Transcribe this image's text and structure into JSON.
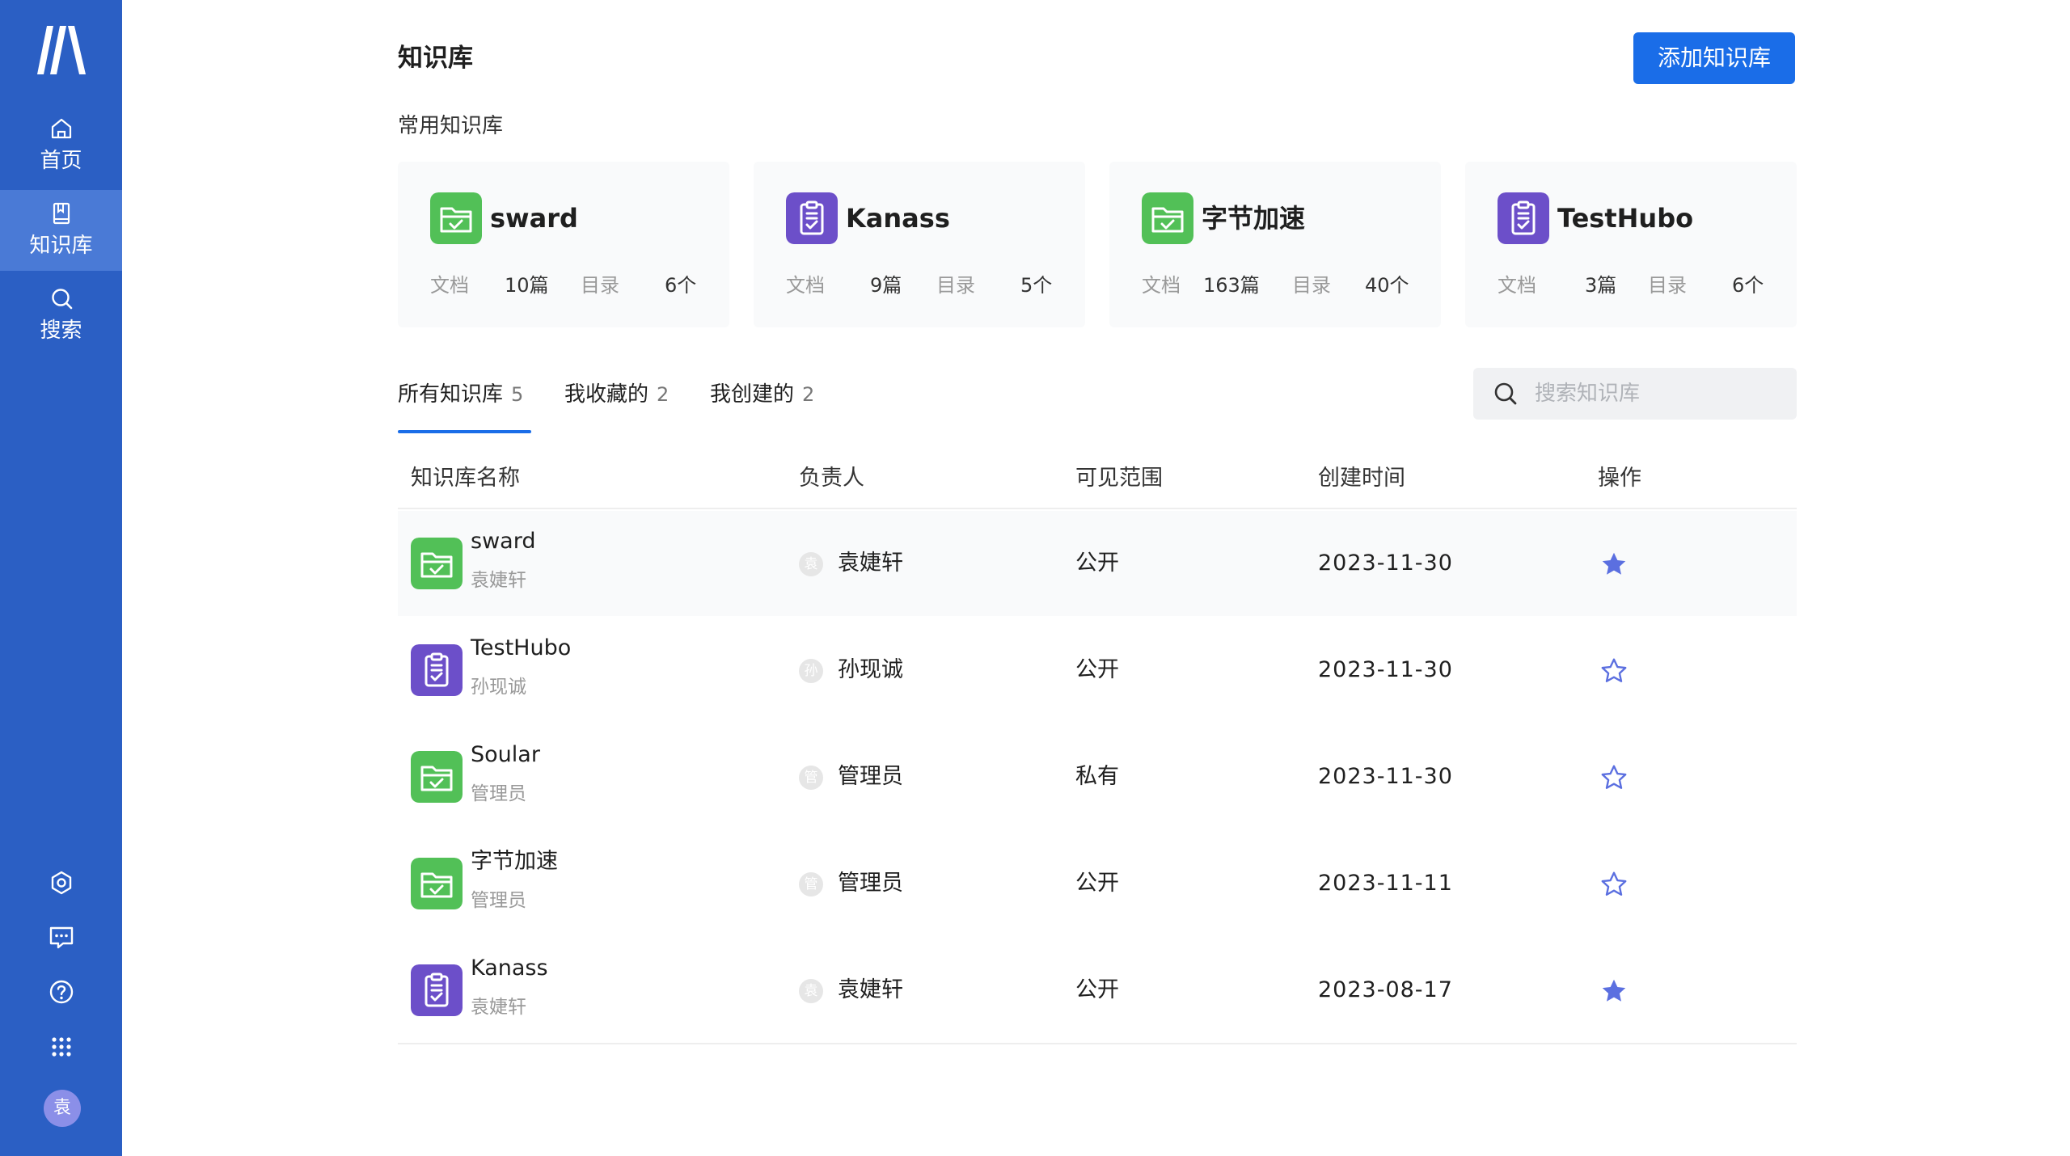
{
  "sidebar": {
    "nav": [
      {
        "label": "首页",
        "icon": "home-icon"
      },
      {
        "label": "知识库",
        "icon": "book-icon"
      },
      {
        "label": "搜索",
        "icon": "search-icon"
      }
    ],
    "bottom_icons": [
      "settings-icon",
      "message-icon",
      "help-icon",
      "apps-grid-icon"
    ],
    "user_avatar": "袁"
  },
  "header": {
    "title": "知识库",
    "add_button": "添加知识库"
  },
  "common_section": {
    "title": "常用知识库",
    "cards": [
      {
        "name": "sward",
        "type": "folder",
        "doc_label": "文档",
        "doc_count": "10篇",
        "dir_label": "目录",
        "dir_count": "6个"
      },
      {
        "name": "Kanass",
        "type": "clipboard",
        "doc_label": "文档",
        "doc_count": "9篇",
        "dir_label": "目录",
        "dir_count": "5个"
      },
      {
        "name": "字节加速",
        "type": "folder",
        "doc_label": "文档",
        "doc_count": "163篇",
        "dir_label": "目录",
        "dir_count": "40个"
      },
      {
        "name": "TestHubo",
        "type": "clipboard",
        "doc_label": "文档",
        "doc_count": "3篇",
        "dir_label": "目录",
        "dir_count": "6个"
      }
    ]
  },
  "tabs": [
    {
      "label": "所有知识库",
      "count": "5",
      "active": true
    },
    {
      "label": "我收藏的",
      "count": "2",
      "active": false
    },
    {
      "label": "我创建的",
      "count": "2",
      "active": false
    }
  ],
  "search": {
    "placeholder": "搜索知识库",
    "value": ""
  },
  "table": {
    "columns": [
      "知识库名称",
      "负责人",
      "可见范围",
      "创建时间",
      "操作"
    ],
    "rows": [
      {
        "name": "sward",
        "sub": "袁婕轩",
        "type": "folder",
        "owner_avatar": "袁",
        "owner": "袁婕轩",
        "visibility": "公开",
        "date": "2023-11-30",
        "starred": true
      },
      {
        "name": "TestHubo",
        "sub": "孙现诚",
        "type": "clipboard",
        "owner_avatar": "孙",
        "owner": "孙现诚",
        "visibility": "公开",
        "date": "2023-11-30",
        "starred": false
      },
      {
        "name": "Soular",
        "sub": "管理员",
        "type": "folder",
        "owner_avatar": "管",
        "owner": "管理员",
        "visibility": "私有",
        "date": "2023-11-30",
        "starred": false
      },
      {
        "name": "字节加速",
        "sub": "管理员",
        "type": "folder",
        "owner_avatar": "管",
        "owner": "管理员",
        "visibility": "公开",
        "date": "2023-11-11",
        "starred": false
      },
      {
        "name": "Kanass",
        "sub": "袁婕轩",
        "type": "clipboard",
        "owner_avatar": "袁",
        "owner": "袁婕轩",
        "visibility": "公开",
        "date": "2023-08-17",
        "starred": true
      }
    ]
  },
  "colors": {
    "sidebar": "#2b5fc4",
    "accent": "#1a6de8",
    "folder": "#52c057",
    "clipboard": "#6c4fc9",
    "star": "#5b6fe0"
  }
}
